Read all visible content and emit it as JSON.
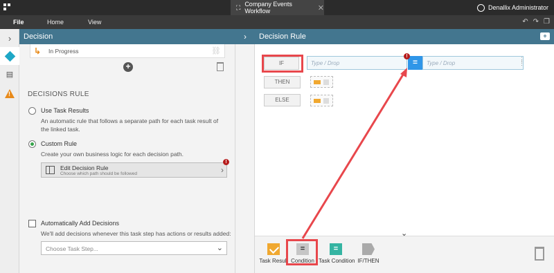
{
  "window": {
    "tab_title": "Company Events Workflow",
    "user_name": "Denallix Administrator"
  },
  "menu": {
    "file": "File",
    "home": "Home",
    "view": "View"
  },
  "left_panel": {
    "title": "Decision",
    "status": "In Progress",
    "section_title": "DECISIONS RULE",
    "use_task_results_label": "Use Task Results",
    "use_task_results_desc": "An automatic rule that follows a separate path for each task result of the linked task.",
    "custom_rule_label": "Custom Rule",
    "custom_rule_desc": "Create your own business logic for each decision path.",
    "edit_rule_title": "Edit Decision Rule",
    "edit_rule_sub": "Choose which path should be followed",
    "auto_add_label": "Automatically Add Decisions",
    "auto_add_desc": "We'll add decisions whenever this task step has actions or results added:",
    "choose_step_placeholder": "Choose Task Step...",
    "selected_option": "custom_rule"
  },
  "right_panel": {
    "title": "Decision Rule",
    "if_label": "IF",
    "then_label": "THEN",
    "else_label": "ELSE",
    "drop_left": "Type / Drop",
    "drop_right": "Type / Drop",
    "operator": "="
  },
  "toolbox": {
    "items": [
      {
        "label": "Task Result",
        "icon": "task-result-icon"
      },
      {
        "label": "Condition",
        "icon": "condition-icon"
      },
      {
        "label": "Task Condition",
        "icon": "task-condition-icon"
      },
      {
        "label": "IF/THEN",
        "icon": "if-then-icon"
      }
    ]
  },
  "colors": {
    "header": "#43768f",
    "accent_orange": "#f0a830",
    "operator_blue": "#2f96e8",
    "highlight_red": "#e8474c",
    "radio_green": "#36a34a"
  }
}
